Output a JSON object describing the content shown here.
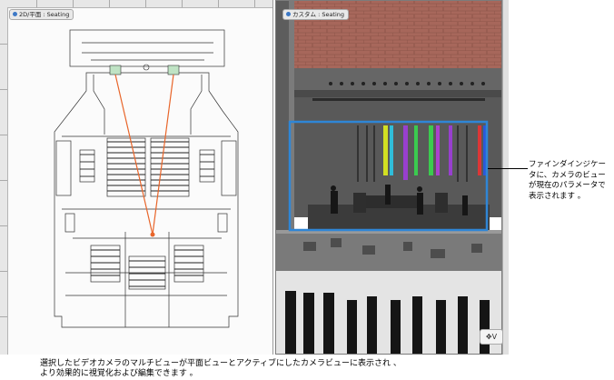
{
  "plan_view": {
    "tag": "2D/平面 : Seating"
  },
  "camera_view": {
    "tag": "カスタム : Seating"
  },
  "callout": {
    "text": "ファインダインジケータに、カメラのビューが現在のパラメータで表示されます 。"
  },
  "caption": {
    "line1": "選択したビデオカメラのマルチビューが平面ビューとアクティブにしたカメラビューに表示され 、",
    "line2": "より効果的に視覚化および編集できます 。"
  },
  "corner_widget": {
    "label": "V"
  },
  "colors": {
    "finder_indicator": "#2f86d6",
    "camera_line": "#e8652a",
    "brick_wall": "#a7675b",
    "tag_accent": "#3c78c6"
  },
  "icons": [
    "viewport-dot-icon",
    "view-widget-icon"
  ]
}
